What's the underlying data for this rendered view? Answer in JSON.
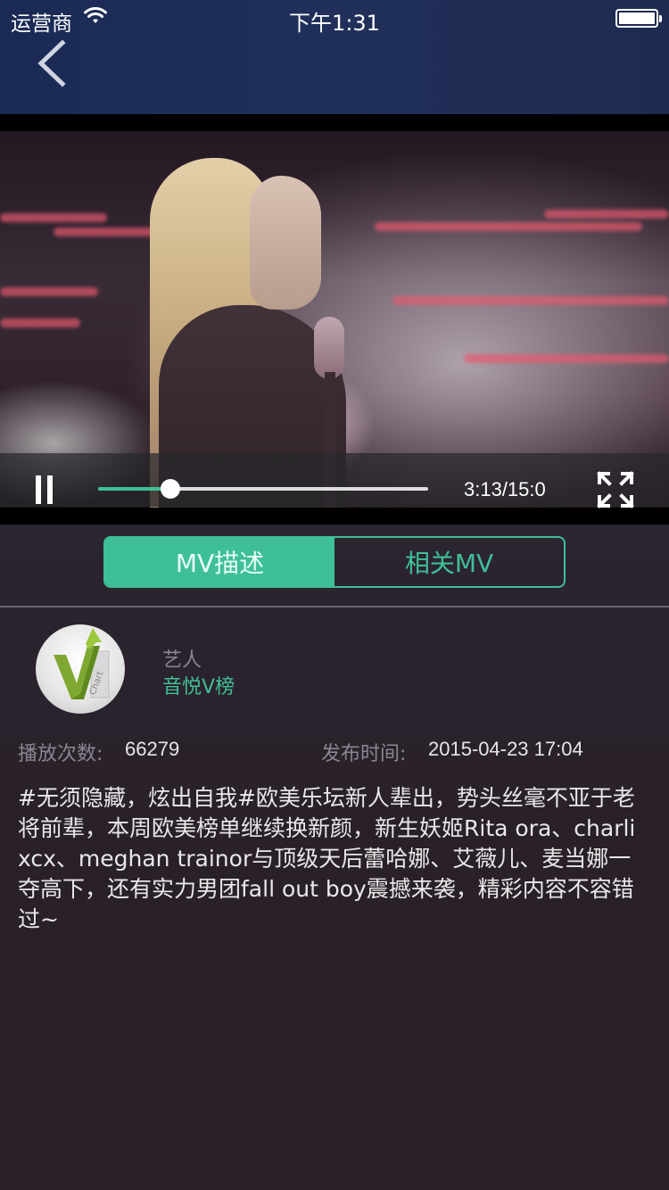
{
  "status_bar": {
    "carrier": "运营商",
    "time": "下午1:31"
  },
  "player": {
    "current_time": "3:13",
    "total_time": "15:0",
    "time_display": "3:13/15:0",
    "progress_fraction": 0.22
  },
  "tabs": [
    {
      "label": "MV描述",
      "active": true
    },
    {
      "label": "相关MV",
      "active": false
    }
  ],
  "artist": {
    "label": "艺人",
    "name": "音悦V榜"
  },
  "stats": {
    "plays_label": "播放次数:",
    "plays_value": "66279",
    "release_label": "发布时间:",
    "release_value": "2015-04-23 17:04"
  },
  "description": "#无须隐藏，炫出自我#欧美乐坛新人辈出，势头丝毫不亚于老将前辈，本周欧美榜单继续换新颜，新生妖姬Rita ora、charli xcx、meghan trainor与顶级天后蕾哈娜、艾薇儿、麦当娜一夺高下，还有实力男团fall out boy震撼来袭，精彩内容不容错过~",
  "colors": {
    "accent": "#3fbf98",
    "nav_bar": "#1e2b50",
    "background": "#2a2430"
  },
  "icons": {
    "back": "chevron-left-icon",
    "pause": "pause-icon",
    "fullscreen": "fullscreen-icon",
    "wifi": "wifi-icon",
    "battery": "battery-icon"
  }
}
